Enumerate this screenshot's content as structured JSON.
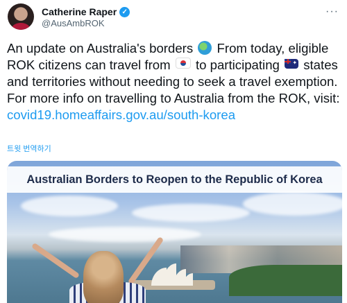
{
  "author": {
    "name": "Catherine Raper",
    "handle": "@AusAmbROK"
  },
  "tweet": {
    "part1": "An update on Australia's borders",
    "part2": " From today, eligible ROK citizens can travel from",
    "part3": " to participating",
    "part4": " states and territories without needing to seek a travel exemption. For more info on travelling to Australia from the ROK, visit:",
    "link": "covid19.homeaffairs.gov.au/south-korea"
  },
  "translate_label": "트윗 번역하기",
  "media": {
    "banner_text": "Australian Borders to Reopen to the Republic of Korea"
  },
  "icons": {
    "verified": "verified-badge-icon",
    "more": "more-options-icon",
    "globe": "globe-asia-australia-emoji",
    "flag_kr": "south-korea-flag-emoji",
    "flag_au": "australia-flag-emoji"
  },
  "colors": {
    "link": "#1d9bf0",
    "verified": "#1d9bf0"
  }
}
